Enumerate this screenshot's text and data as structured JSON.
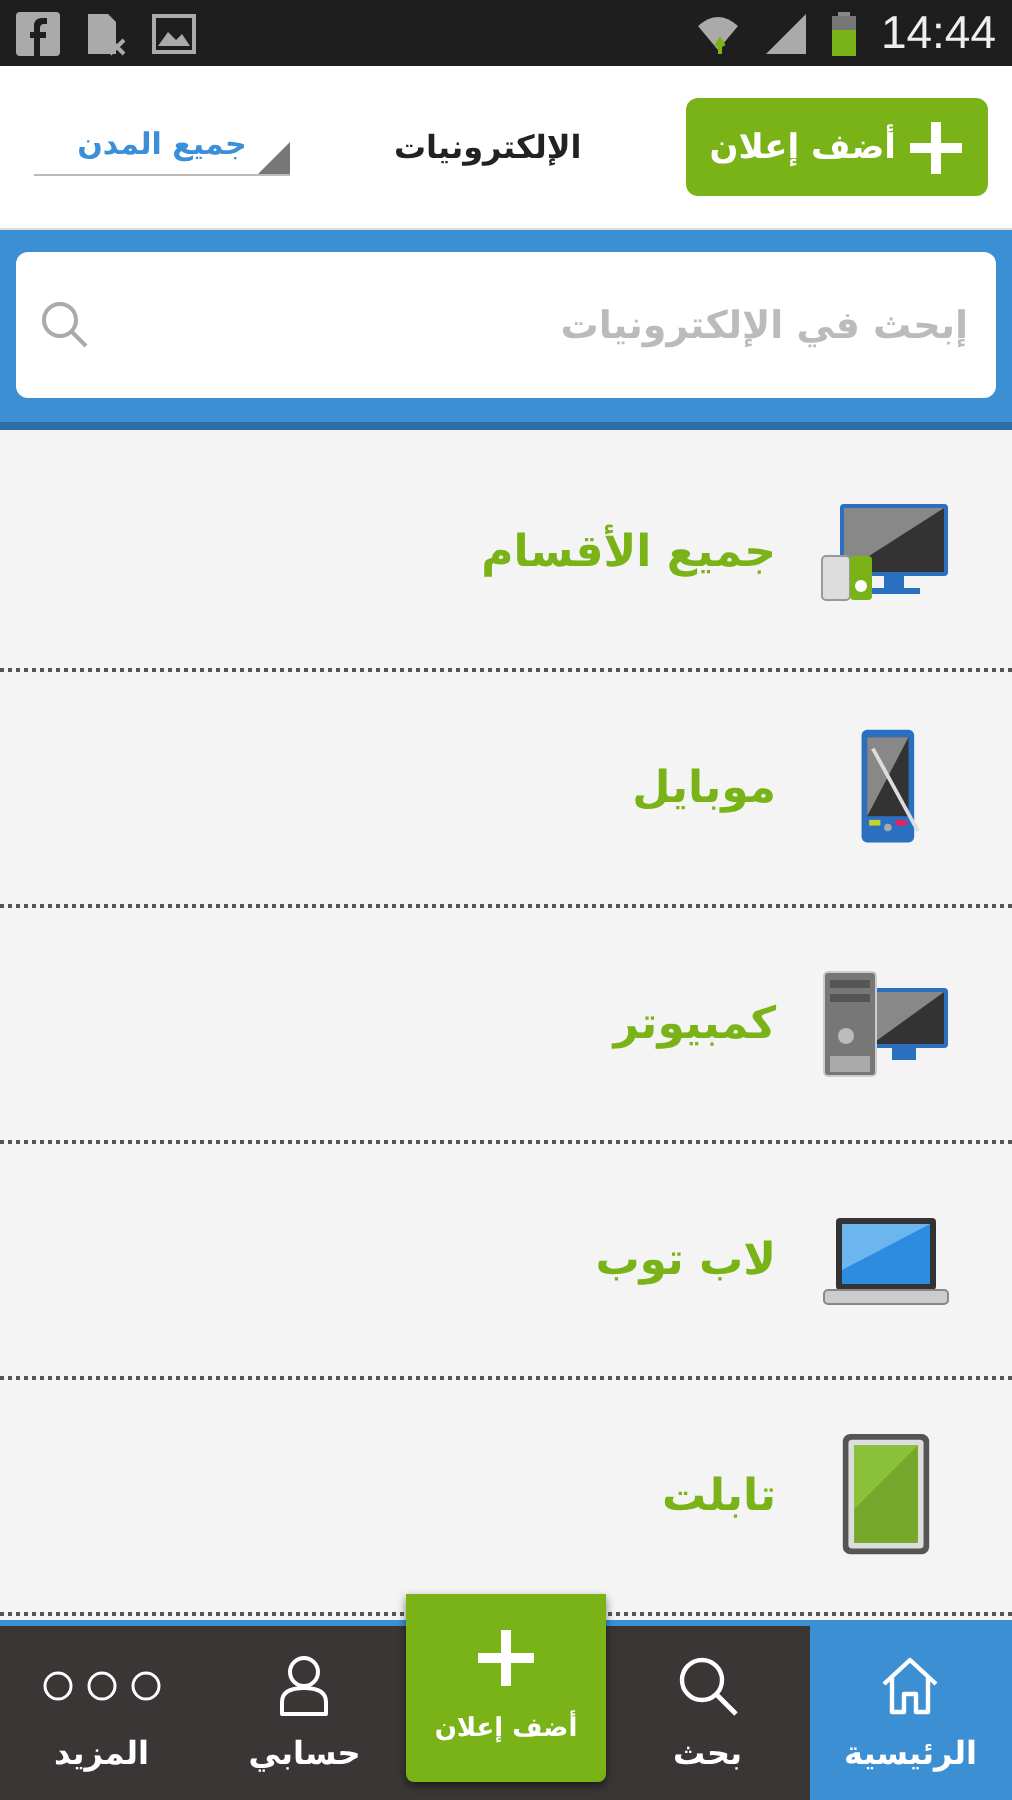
{
  "status_bar": {
    "time": "14:44"
  },
  "header": {
    "add_button": "أضف إعلان",
    "title": "الإلكترونيات",
    "city_dropdown": "جميع المدن"
  },
  "search": {
    "placeholder": "إبحث في الإلكترونيات"
  },
  "categories": [
    {
      "label": "جميع الأقسام",
      "kind": "all"
    },
    {
      "label": "موبايل",
      "kind": "mobile"
    },
    {
      "label": "كمبيوتر",
      "kind": "computer"
    },
    {
      "label": "لاب توب",
      "kind": "laptop"
    },
    {
      "label": "تابلت",
      "kind": "tablet"
    }
  ],
  "bottom_nav": [
    {
      "label": "الرئيسية",
      "kind": "home",
      "selected": true
    },
    {
      "label": "بحث",
      "kind": "search",
      "selected": false
    },
    {
      "label": "أضف إعلان",
      "kind": "add",
      "selected": false
    },
    {
      "label": "حسابي",
      "kind": "account",
      "selected": false
    },
    {
      "label": "المزيد",
      "kind": "more",
      "selected": false
    }
  ]
}
